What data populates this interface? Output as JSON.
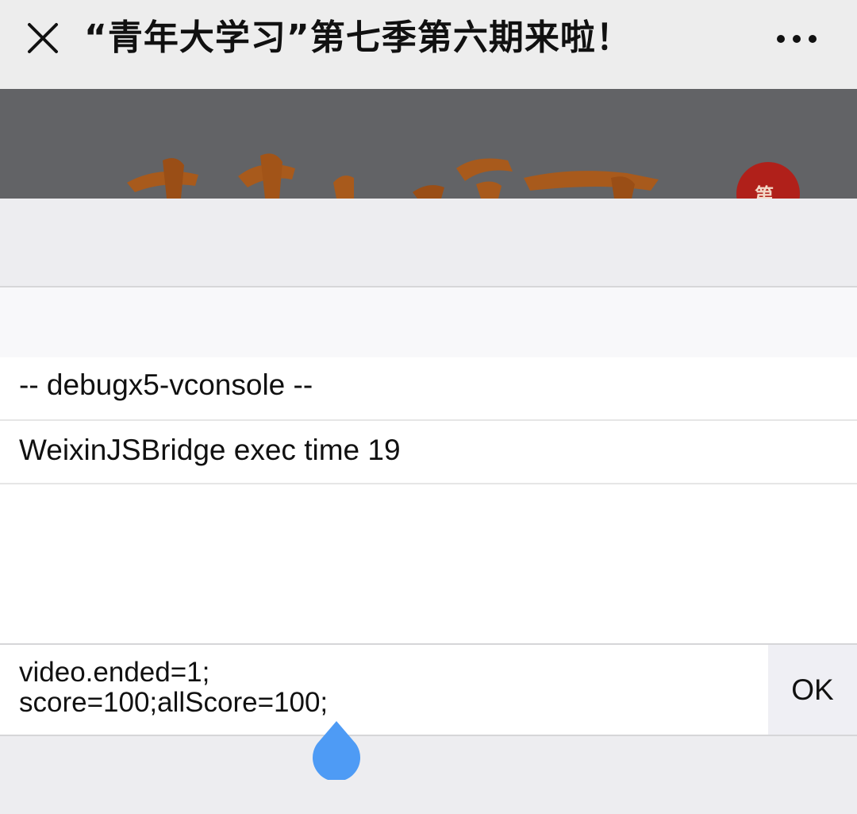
{
  "header": {
    "title": "“青年大学习”第七季第六期来啦！"
  },
  "banner": {
    "seal_text": "第",
    "colors": {
      "background": "#626366",
      "calligraphy": "#a85a1c",
      "seal": "#b0201a"
    }
  },
  "console": {
    "log_lines": [
      "-- debugx5-vconsole --",
      "WeixinJSBridge exec time 19"
    ],
    "command_lines": [
      "video.ended=1;",
      "score=100;allScore=100;"
    ],
    "ok_label": "OK"
  },
  "colors": {
    "selection_handle": "#4e9bf5"
  },
  "icons": {
    "close": "close-icon",
    "more": "more-icon",
    "handle": "text-selection-handle-icon"
  }
}
